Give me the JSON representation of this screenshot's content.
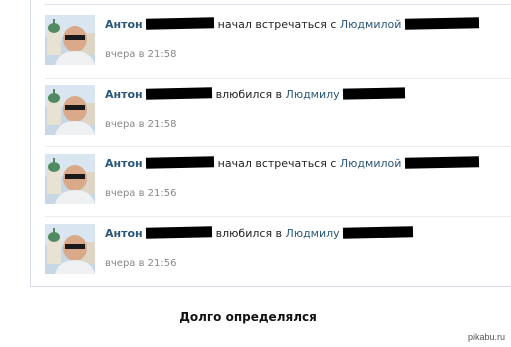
{
  "feed": {
    "entries": [
      {
        "name": "Антон",
        "verb": "начал встречаться с",
        "target": "Людмилой",
        "time": "вчера в 21:58"
      },
      {
        "name": "Антон",
        "verb": "влюбился в",
        "target": "Людмилу",
        "time": "вчера в 21:58"
      },
      {
        "name": "Антон",
        "verb": "начал встречаться с",
        "target": "Людмилой",
        "time": "вчера в 21:56"
      },
      {
        "name": "Антон",
        "verb": "влюбился в",
        "target": "Людмилу",
        "time": "вчера в 21:56"
      }
    ]
  },
  "caption": "Долго определялся",
  "watermark": "pikabu.ru",
  "colors": {
    "link": "#2b587a",
    "time": "#888888",
    "redaction": "#000000",
    "divider": "#d8dfea"
  },
  "icons": {
    "avatar": "avatar-photo"
  }
}
